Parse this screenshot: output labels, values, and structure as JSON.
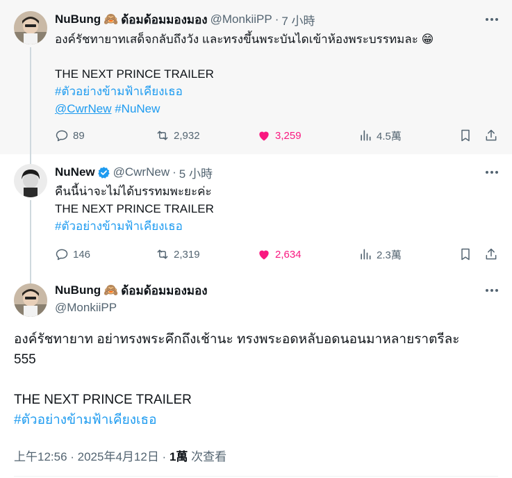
{
  "tweets": [
    {
      "name": "NuBung",
      "name_suffix": "ด้อมด้อมมองมอง",
      "handle": "@MonkiiPP",
      "time": "7 小時",
      "lines": [
        "องค์รัชทายาทเสด็จกลับถึงวัง และทรงขึ้นพระบันไดเข้าห้องพระบรรทมละ 😁",
        "",
        "THE NEXT PRINCE TRAILER"
      ],
      "hashtag": "#ตัวอย่างข้ามฟ้าเคียงเธอ",
      "mention": "@CwrNew",
      "hashtag2": "#NuNew",
      "replies": "89",
      "retweets": "2,932",
      "likes": "3,259",
      "views": "4.5萬"
    },
    {
      "name": "NuNew",
      "handle": "@CwrNew",
      "time": "5 小時",
      "lines": [
        "คืนนี้น่าจะไม่ได้บรรทมพะยะค่ะ",
        "THE NEXT PRINCE TRAILER"
      ],
      "hashtag": "#ตัวอย่างข้ามฟ้าเคียงเธอ",
      "replies": "146",
      "retweets": "2,319",
      "likes": "2,634",
      "views": "2.3萬"
    },
    {
      "name": "NuBung",
      "name_suffix": "ด้อมด้อมมองมอง",
      "handle": "@MonkiiPP",
      "line1": "องค์รัชทายาท อย่าทรงพระคึกถึงเช้านะ ทรงพระอดหลับอดนอนมาหลายราตรีละ",
      "line2": "555",
      "line3": "THE NEXT PRINCE TRAILER",
      "hashtag": "#ตัวอย่างข้ามฟ้าเคียงเธอ",
      "timestamp": "上午12:56 · 2025年4月12日 · ",
      "views_count": "1萬",
      "views_label": " 次查看"
    }
  ],
  "colors": {
    "link": "#1d9bf0",
    "like": "#f91880",
    "muted": "#536471",
    "verified": "#1d9bf0"
  },
  "icons": [
    "reply-icon",
    "retweet-icon",
    "heart-icon",
    "views-icon",
    "bookmark-icon",
    "share-icon",
    "more-icon",
    "verified-icon",
    "see-no-evil-monkey-icon"
  ]
}
